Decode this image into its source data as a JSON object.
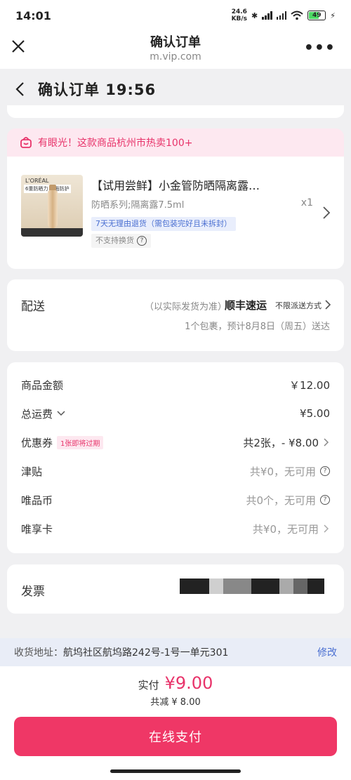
{
  "status_bar": {
    "time": "14:01",
    "speed_value": "24.6",
    "speed_unit": "KB/s",
    "battery": "49"
  },
  "browser": {
    "title": "确认订单",
    "url": "m.vip.com"
  },
  "header": {
    "title": "确认订单 19:56"
  },
  "promo": {
    "text": "有眼光！这款商品杭州市热卖100+"
  },
  "product": {
    "name": "【试用尝鲜】小金管防晒隔离露…",
    "spec": "防晒系列;隔离露7.5ml",
    "qty": "x1",
    "return_tag": "7天无理由退货（需包装完好且未拆封）",
    "exchange_tag": "不支持换货",
    "thumb_brand": "L'ORÉAL",
    "thumb_tag": "6重防晒力 全面防护"
  },
  "delivery": {
    "label": "配送",
    "note": "（以实际发货为准）",
    "carrier": "顺丰速运",
    "method": "不限派送方式",
    "estimate": "1个包裹，预计8月8日（周五）送达"
  },
  "prices": {
    "goods_label": "商品金额",
    "goods_value": "￥12.00",
    "shipping_label": "总运费",
    "shipping_value": "¥5.00",
    "coupon_label": "优惠券",
    "coupon_badge": "1张即将过期",
    "coupon_value": "共2张，- ¥8.00",
    "allowance_label": "津贴",
    "allowance_value": "共¥0，无可用",
    "coin_label": "唯品币",
    "coin_value": "共0个，无可用",
    "card_label": "唯享卡",
    "card_value": "共¥0，无可用"
  },
  "invoice": {
    "label": "发票"
  },
  "address": {
    "label": "收货地址：",
    "value": "航坞社区航坞路242号-1号一单元301",
    "edit": "修改"
  },
  "checkout": {
    "pay_label": "实付",
    "pay_amount": "¥9.00",
    "saved": "共减 ¥ 8.00",
    "button": "在线支付"
  },
  "colors": {
    "accent": "#ef3766",
    "link": "#4a6fd1"
  }
}
